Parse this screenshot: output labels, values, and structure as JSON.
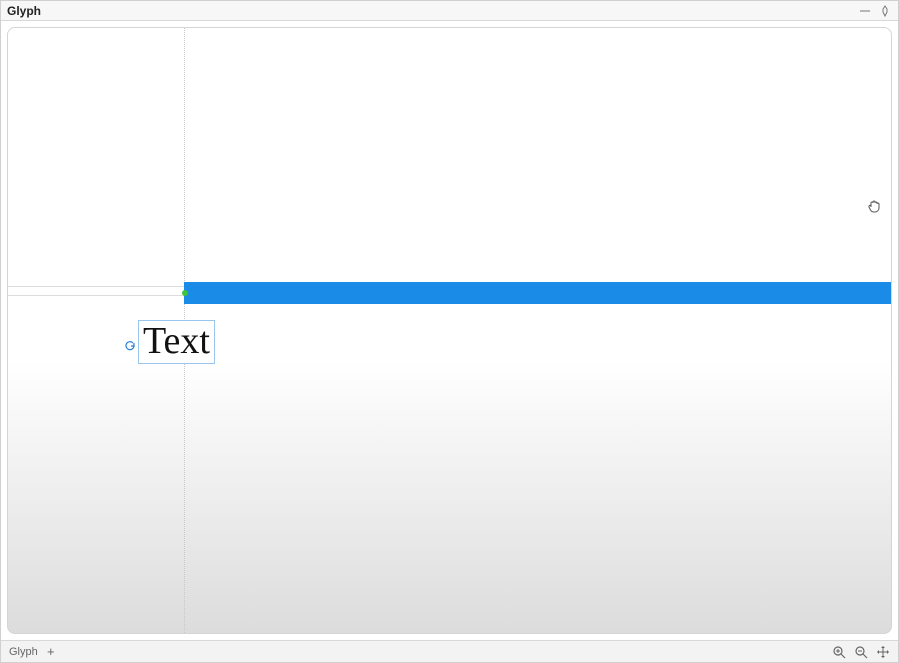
{
  "panel": {
    "title": "Glyph"
  },
  "canvas": {
    "text_value": "Text",
    "bar_color": "#1a8be6"
  },
  "footer": {
    "tab_label": "Glyph"
  }
}
